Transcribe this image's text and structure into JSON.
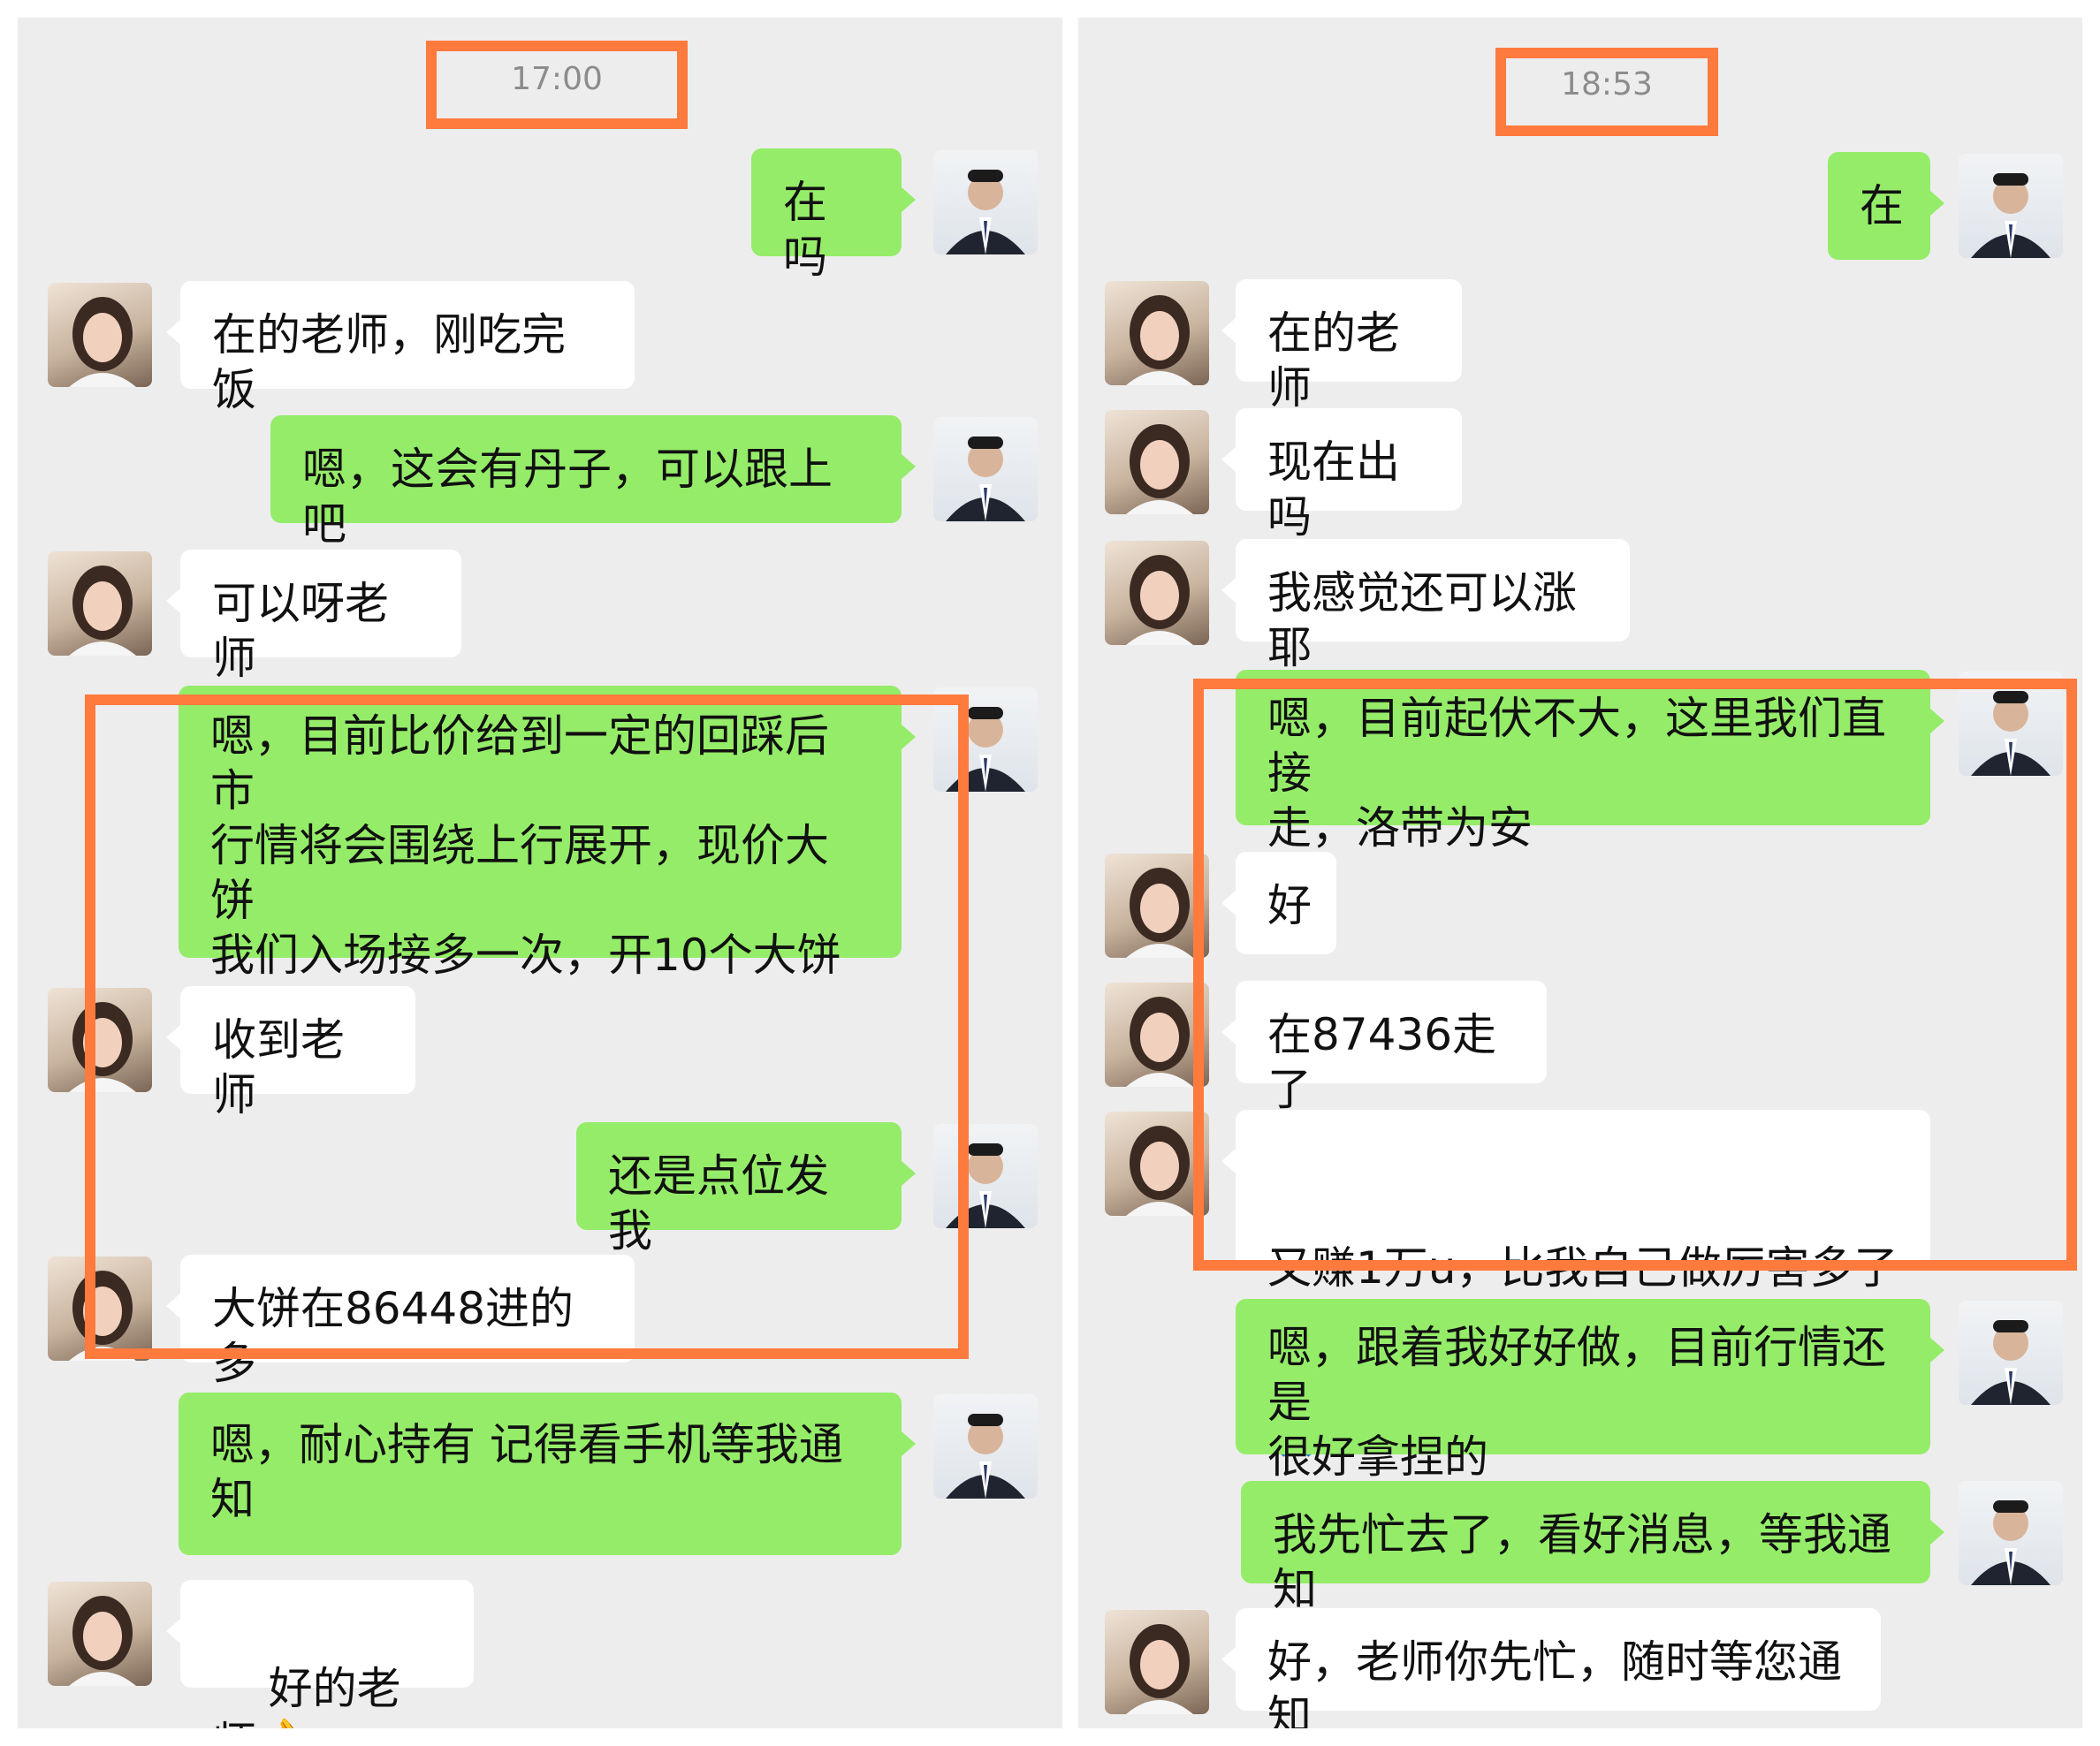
{
  "left": {
    "time": "17:00",
    "messages": [
      {
        "from": "teacher",
        "text": "在吗"
      },
      {
        "from": "student",
        "text": "在的老师，刚吃完饭"
      },
      {
        "from": "teacher",
        "text": "嗯，这会有丹子，可以跟上吧"
      },
      {
        "from": "student",
        "text": "可以呀老师"
      },
      {
        "from": "teacher",
        "text": "嗯，目前比价给到一定的回踩后市\n行情将会围绕上行展开，现价大饼\n我们入场接多一次，开10个大饼\n进去"
      },
      {
        "from": "student",
        "text": "收到老师"
      },
      {
        "from": "teacher",
        "text": "还是点位发我"
      },
      {
        "from": "student",
        "text": "大饼在86448进的多"
      },
      {
        "from": "teacher",
        "text": "嗯，耐心持有 记得看手机等我通\n知"
      },
      {
        "from": "student",
        "text": "好的老师",
        "emoji": "👌"
      }
    ]
  },
  "right": {
    "time": "18:53",
    "messages": [
      {
        "from": "teacher",
        "text": "在"
      },
      {
        "from": "student",
        "text": "在的老师"
      },
      {
        "from": "student",
        "text": "现在出吗"
      },
      {
        "from": "student",
        "text": "我感觉还可以涨耶"
      },
      {
        "from": "teacher",
        "text": "嗯，目前起伏不大，这里我们直接\n走，洛带为安"
      },
      {
        "from": "student",
        "text": "好"
      },
      {
        "from": "student",
        "text": "在87436走了"
      },
      {
        "from": "student",
        "text": "又赚1万u，比我自己做厉害多了",
        "emoji": "🙏"
      },
      {
        "from": "teacher",
        "text": "嗯，跟着我好好做，目前行情还是\n很好拿捏的"
      },
      {
        "from": "teacher",
        "text": "我先忙去了，看好消息，等我通知"
      },
      {
        "from": "student",
        "text": "好，老师你先忙，随时等您通知"
      }
    ]
  },
  "colors": {
    "sent_bubble": "#95ec69",
    "received_bubble": "#ffffff",
    "highlight": "#ff7a3d",
    "background": "#ededed"
  },
  "icons": {
    "teacher_avatar": "man-in-suit-avatar",
    "student_avatar": "woman-selfie-avatar"
  }
}
